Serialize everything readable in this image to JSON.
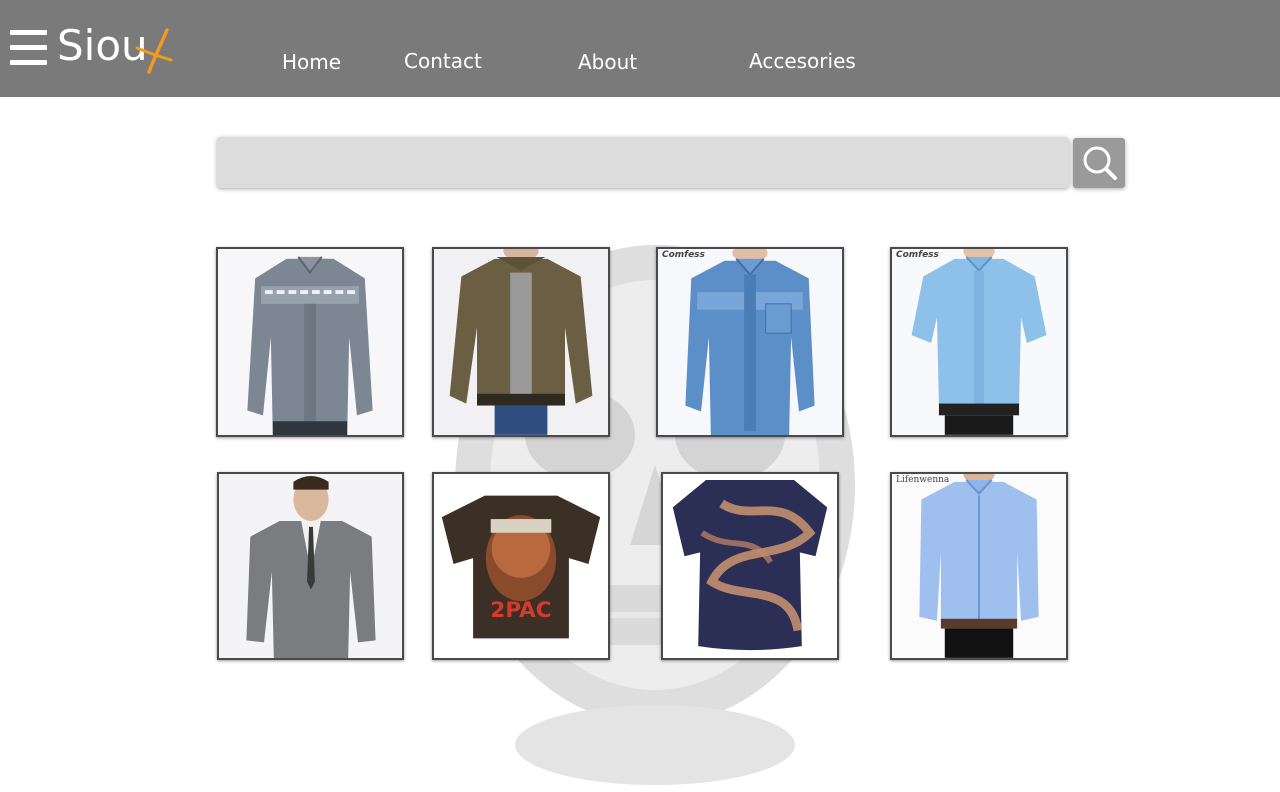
{
  "brand": {
    "name": "Siou",
    "accent_color": "#f29a1e"
  },
  "nav": {
    "items": [
      {
        "label": "Home"
      },
      {
        "label": "Contact"
      },
      {
        "label": "About"
      },
      {
        "label": "Accesories"
      }
    ]
  },
  "search": {
    "placeholder": ""
  },
  "products": [
    {
      "name": "gray denim shirt with greek key pattern",
      "brand_label": ""
    },
    {
      "name": "olive bomber jacket",
      "brand_label": ""
    },
    {
      "name": "blue denim long sleeve shirt",
      "brand_label": "Comfess"
    },
    {
      "name": "light blue short sleeve shirt",
      "brand_label": "Comfess"
    },
    {
      "name": "gray suit",
      "brand_label": ""
    },
    {
      "name": "2pac graphic t-shirt",
      "brand_label": ""
    },
    {
      "name": "bleached navy t-shirt",
      "brand_label": ""
    },
    {
      "name": "light blue button down shirt",
      "brand_label": "Lifenwenna"
    }
  ],
  "icons": {
    "menu": "hamburger-icon",
    "search": "search-icon",
    "logo_x": "x-brush-icon"
  }
}
